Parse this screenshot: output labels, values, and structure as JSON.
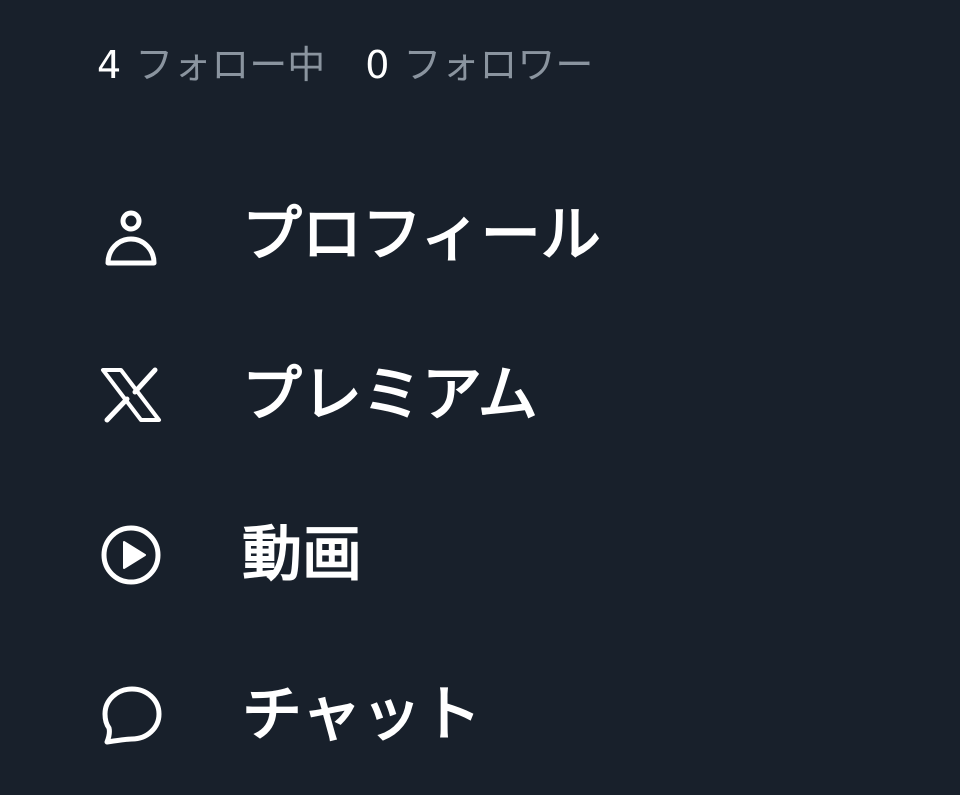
{
  "stats": {
    "following_count": "4",
    "following_label": "フォロー中",
    "followers_count": "0",
    "followers_label": "フォロワー"
  },
  "menu": {
    "items": [
      {
        "label": "プロフィール",
        "icon": "person-icon"
      },
      {
        "label": "プレミアム",
        "icon": "x-logo-icon"
      },
      {
        "label": "動画",
        "icon": "play-circle-icon"
      },
      {
        "label": "チャット",
        "icon": "chat-bubble-icon"
      }
    ]
  },
  "colors": {
    "background": "#18202b",
    "primary_text": "#ffffff",
    "secondary_text": "#8a949f"
  }
}
